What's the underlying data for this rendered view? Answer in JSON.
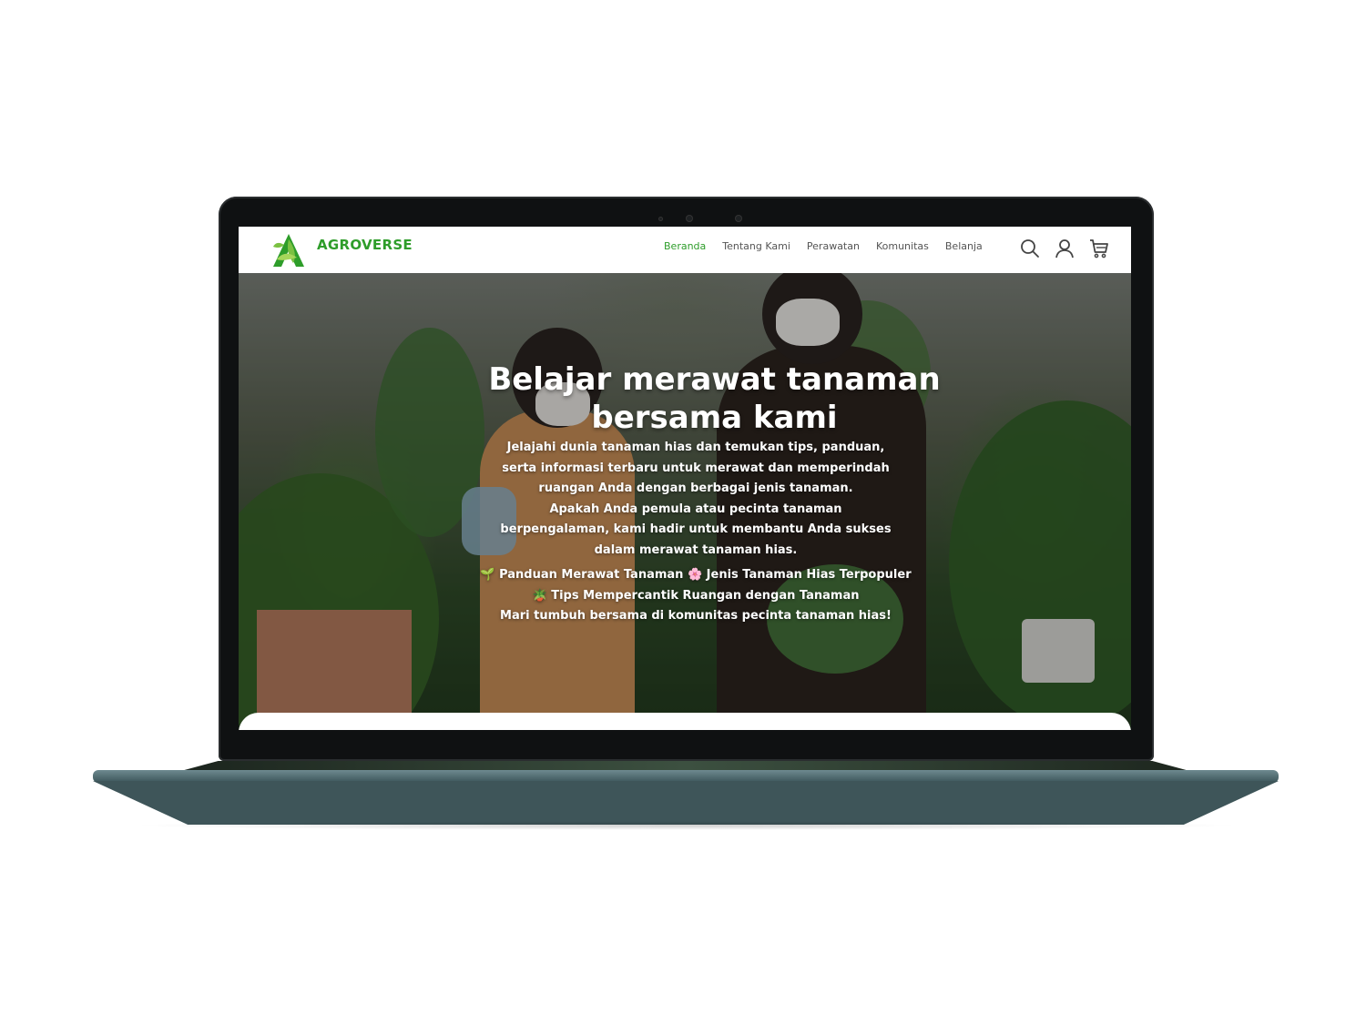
{
  "brand": {
    "name": "AGROVERSE",
    "accent_color": "#2e9d2a"
  },
  "nav": {
    "items": [
      {
        "label": "Beranda",
        "active": true
      },
      {
        "label": "Tentang Kami",
        "active": false
      },
      {
        "label": "Perawatan",
        "active": false
      },
      {
        "label": "Komunitas",
        "active": false
      },
      {
        "label": "Belanja",
        "active": false
      }
    ],
    "icons": [
      "search-icon",
      "user-icon",
      "cart-icon"
    ]
  },
  "hero": {
    "title_line1": "Belajar merawat tanaman",
    "title_line2": "bersama kami",
    "description": "Jelajahi dunia tanaman hias dan temukan tips, panduan,\nserta informasi terbaru untuk merawat dan memperindah\nruangan Anda dengan berbagai jenis tanaman.\nApakah Anda pemula atau pecinta tanaman\nberpengalaman, kami hadir untuk membantu Anda sukses\ndalam merawat tanaman hias.",
    "feature1": "🌱 Panduan Merawat Tanaman 🌸 Jenis Tanaman Hias Terpopuler",
    "feature2": "🪴 Tips Mempercantik Ruangan dengan Tanaman",
    "closing": "Mari tumbuh bersama di komunitas pecinta tanaman hias!"
  }
}
